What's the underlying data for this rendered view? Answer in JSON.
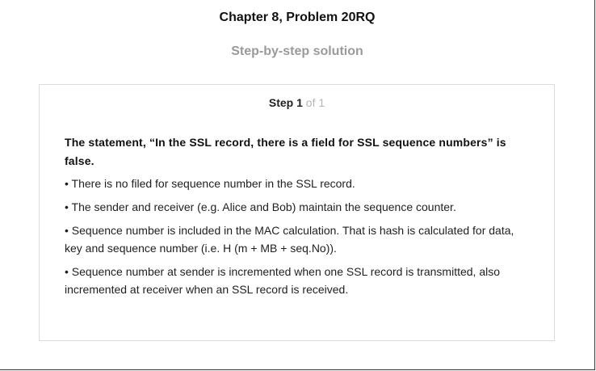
{
  "header": {
    "chapter_title": "Chapter 8, Problem 20RQ",
    "subtitle": "Step-by-step solution"
  },
  "step": {
    "label": "Step",
    "number": "1",
    "of_text": "of 1"
  },
  "solution": {
    "statement": "The statement, “In the SSL record, there is a field for SSL sequence numbers” is false.",
    "bullets": [
      "• There is no filed for sequence number in the SSL record.",
      "• The sender and receiver (e.g. Alice and Bob) maintain the sequence counter.",
      "• Sequence number is included in the MAC calculation. That is hash is calculated for data, key and sequence number (i.e. H (m + MB + seq.No)).",
      "• Sequence number at sender is incremented when one SSL record is transmitted, also incremented at receiver when an SSL record is received."
    ]
  }
}
